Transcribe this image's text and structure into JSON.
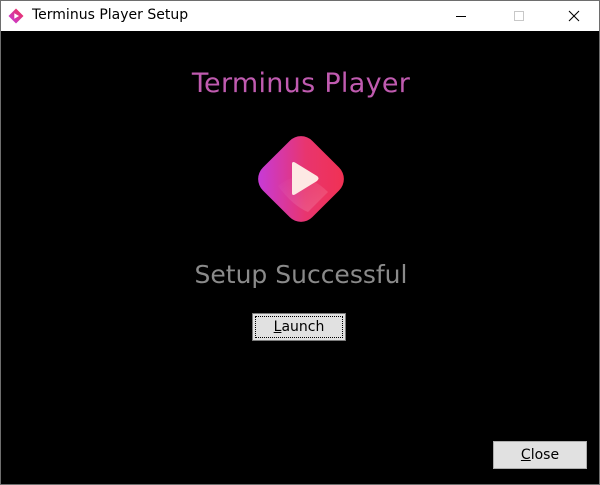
{
  "window": {
    "title": "Terminus Player Setup",
    "controls": {
      "minimize": "minimize-icon",
      "maximize": "maximize-icon",
      "close": "close-icon"
    }
  },
  "main": {
    "product_title": "Terminus Player",
    "status": "Setup Successful",
    "launch_button": {
      "mnemonic": "L",
      "rest": "aunch"
    },
    "close_button": {
      "mnemonic": "C",
      "rest": "lose"
    }
  },
  "colors": {
    "background": "#000000",
    "title_accent": "#c05bb0",
    "status_text": "#8a8a8a",
    "logo_gradient_start": "#c23be6",
    "logo_gradient_end": "#f2304f"
  }
}
